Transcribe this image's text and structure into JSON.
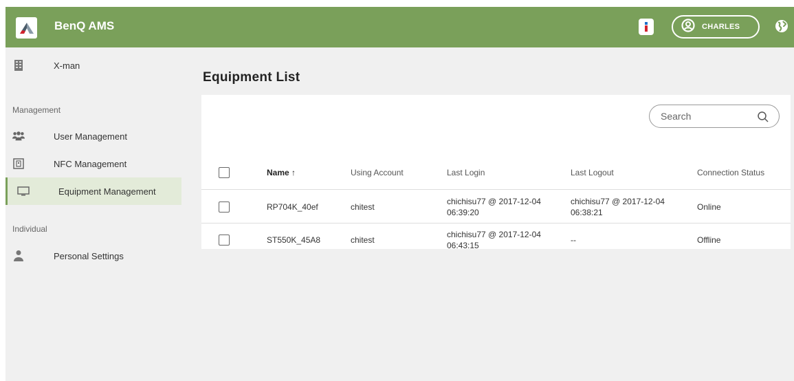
{
  "app": {
    "title": "BenQ AMS",
    "accent": "#7aa05a"
  },
  "header": {
    "user_name": "CHARLES"
  },
  "sidebar": {
    "org_name": "X-man",
    "sections": {
      "management": "Management",
      "individual": "Individual"
    },
    "items": [
      {
        "label": "User Management",
        "icon": "users-icon"
      },
      {
        "label": "NFC Management",
        "icon": "nfc-icon"
      },
      {
        "label": "Equipment Management",
        "icon": "monitor-icon",
        "active": true
      },
      {
        "label": "Personal Settings",
        "icon": "person-icon"
      }
    ]
  },
  "main": {
    "title": "Equipment List",
    "search_placeholder": "Search",
    "columns": {
      "name": "Name ↑",
      "account": "Using Account",
      "last_login": "Last Login",
      "last_logout": "Last Logout",
      "status": "Connection Status"
    },
    "rows": [
      {
        "name": "RP704K_40ef",
        "account": "chitest",
        "last_login": "chichisu77 @ 2017-12-04 06:39:20",
        "last_logout": "chichisu77 @ 2017-12-04 06:38:21",
        "status": "Online"
      },
      {
        "name": "ST550K_45A8",
        "account": "chitest",
        "last_login": "chichisu77 @ 2017-12-04 06:43:15",
        "last_logout": "--",
        "status": "Offline"
      }
    ]
  }
}
